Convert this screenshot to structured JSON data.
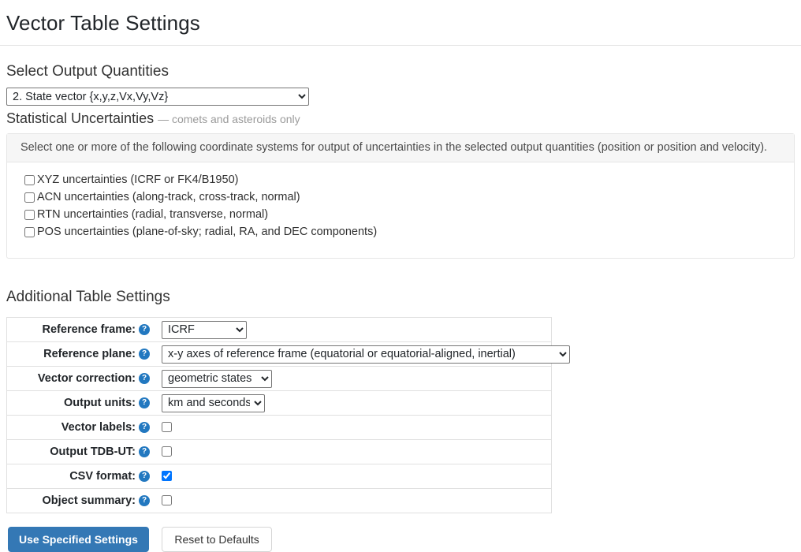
{
  "header": {
    "title": "Vector Table Settings"
  },
  "quantities": {
    "heading": "Select Output Quantities",
    "selected": "2. State vector {x,y,z,Vx,Vy,Vz}",
    "options": [
      "2. State vector {x,y,z,Vx,Vy,Vz}"
    ]
  },
  "uncertainties": {
    "heading": "Statistical Uncertainties",
    "heading_note": "— comets and asteroids only",
    "panel_note": "Select one or more of the following coordinate systems for output of uncertainties in the selected output quantities (position or position and velocity).",
    "items": [
      {
        "label": "XYZ uncertainties (ICRF or FK4/B1950)",
        "checked": false
      },
      {
        "label": "ACN uncertainties (along-track, cross-track, normal)",
        "checked": false
      },
      {
        "label": "RTN uncertainties (radial, transverse, normal)",
        "checked": false
      },
      {
        "label": "POS uncertainties (plane-of-sky; radial, RA, and DEC components)",
        "checked": false
      }
    ]
  },
  "additional": {
    "heading": "Additional Table Settings",
    "help_icon": "?",
    "rows": [
      {
        "label": "Reference frame:",
        "type": "select",
        "value": "ICRF",
        "options": [
          "ICRF"
        ]
      },
      {
        "label": "Reference plane:",
        "type": "select",
        "value": "x-y axes of reference frame (equatorial or equatorial-aligned, inertial)",
        "options": [
          "x-y axes of reference frame (equatorial or equatorial-aligned, inertial)"
        ]
      },
      {
        "label": "Vector correction:",
        "type": "select",
        "value": "geometric states",
        "options": [
          "geometric states"
        ]
      },
      {
        "label": "Output units:",
        "type": "select",
        "value": "km and seconds",
        "options": [
          "km and seconds"
        ]
      },
      {
        "label": "Vector labels:",
        "type": "checkbox",
        "checked": false
      },
      {
        "label": "Output TDB-UT:",
        "type": "checkbox",
        "checked": false
      },
      {
        "label": "CSV format:",
        "type": "checkbox",
        "checked": true
      },
      {
        "label": "Object summary:",
        "type": "checkbox",
        "checked": false
      }
    ]
  },
  "buttons": {
    "primary": "Use Specified Settings",
    "secondary": "Reset to Defaults"
  },
  "colors": {
    "accent": "#3478b5",
    "help_icon": "#2278c0",
    "checkbox_checked": "#1a73e8",
    "border": "#e0e0e0",
    "panel_header_bg": "#f6f6f6"
  }
}
